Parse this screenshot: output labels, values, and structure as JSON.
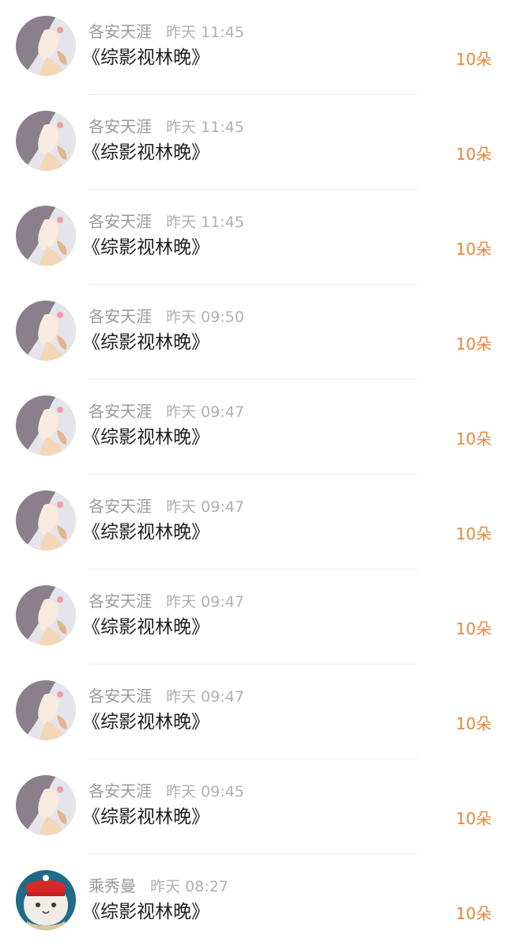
{
  "gifts": [
    {
      "user": "各安天涯",
      "time": "昨天 11:45",
      "book": "《综影视林晚》",
      "count": "10朵",
      "avatar": "anime-girl-icon"
    },
    {
      "user": "各安天涯",
      "time": "昨天 11:45",
      "book": "《综影视林晚》",
      "count": "10朵",
      "avatar": "anime-girl-icon"
    },
    {
      "user": "各安天涯",
      "time": "昨天 11:45",
      "book": "《综影视林晚》",
      "count": "10朵",
      "avatar": "anime-girl-icon"
    },
    {
      "user": "各安天涯",
      "time": "昨天 09:50",
      "book": "《综影视林晚》",
      "count": "10朵",
      "avatar": "anime-girl-icon"
    },
    {
      "user": "各安天涯",
      "time": "昨天 09:47",
      "book": "《综影视林晚》",
      "count": "10朵",
      "avatar": "anime-girl-icon"
    },
    {
      "user": "各安天涯",
      "time": "昨天 09:47",
      "book": "《综影视林晚》",
      "count": "10朵",
      "avatar": "anime-girl-icon"
    },
    {
      "user": "各安天涯",
      "time": "昨天 09:47",
      "book": "《综影视林晚》",
      "count": "10朵",
      "avatar": "anime-girl-icon"
    },
    {
      "user": "各安天涯",
      "time": "昨天 09:47",
      "book": "《综影视林晚》",
      "count": "10朵",
      "avatar": "anime-girl-icon"
    },
    {
      "user": "各安天涯",
      "time": "昨天 09:45",
      "book": "《综影视林晚》",
      "count": "10朵",
      "avatar": "anime-girl-icon"
    },
    {
      "user": "乘秀曼",
      "time": "昨天 08:27",
      "book": "《综影视林晚》",
      "count": "10朵",
      "avatar": "cat-red-hat-icon"
    }
  ],
  "colors": {
    "count": "#e8863a",
    "username": "#9a9a9a",
    "title": "#1f1f1f"
  }
}
